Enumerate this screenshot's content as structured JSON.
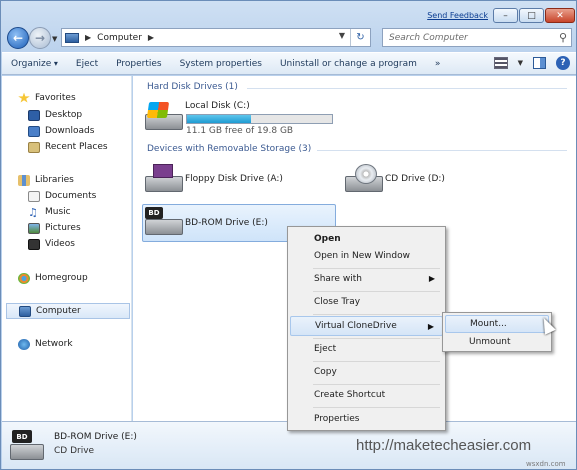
{
  "titlebar": {
    "feedback_link": "Send Feedback"
  },
  "address": {
    "location": "Computer"
  },
  "search": {
    "placeholder": "Search Computer"
  },
  "toolbar": {
    "organize": "Organize",
    "eject": "Eject",
    "properties": "Properties",
    "system_properties": "System properties",
    "uninstall": "Uninstall or change a program",
    "more": "»"
  },
  "sidebar": {
    "favorites": "Favorites",
    "desktop": "Desktop",
    "downloads": "Downloads",
    "recent_places": "Recent Places",
    "libraries": "Libraries",
    "documents": "Documents",
    "music": "Music",
    "pictures": "Pictures",
    "videos": "Videos",
    "homegroup": "Homegroup",
    "computer": "Computer",
    "network": "Network"
  },
  "content": {
    "hdd_group": "Hard Disk Drives (1)",
    "removable_group": "Devices with Removable Storage (3)",
    "local_disk": {
      "name": "Local Disk (C:)",
      "free_text": "11.1 GB free of 19.8 GB",
      "used_fraction": 0.44
    },
    "floppy": "Floppy Disk Drive (A:)",
    "cd": "CD Drive (D:)",
    "bd": "BD-ROM Drive (E:)",
    "bd_tag": "BD"
  },
  "context_menu": {
    "open": "Open",
    "open_new": "Open in New Window",
    "share_with": "Share with",
    "close_tray": "Close Tray",
    "virtual_clonedrive": "Virtual CloneDrive",
    "eject": "Eject",
    "copy": "Copy",
    "create_shortcut": "Create Shortcut",
    "properties": "Properties"
  },
  "submenu": {
    "mount": "Mount...",
    "unmount": "Unmount"
  },
  "details": {
    "name": "BD-ROM Drive (E:)",
    "type": "CD Drive",
    "tag": "BD"
  },
  "watermark": "http://maketecheasier.com",
  "source_mark": "wsxdn.com"
}
